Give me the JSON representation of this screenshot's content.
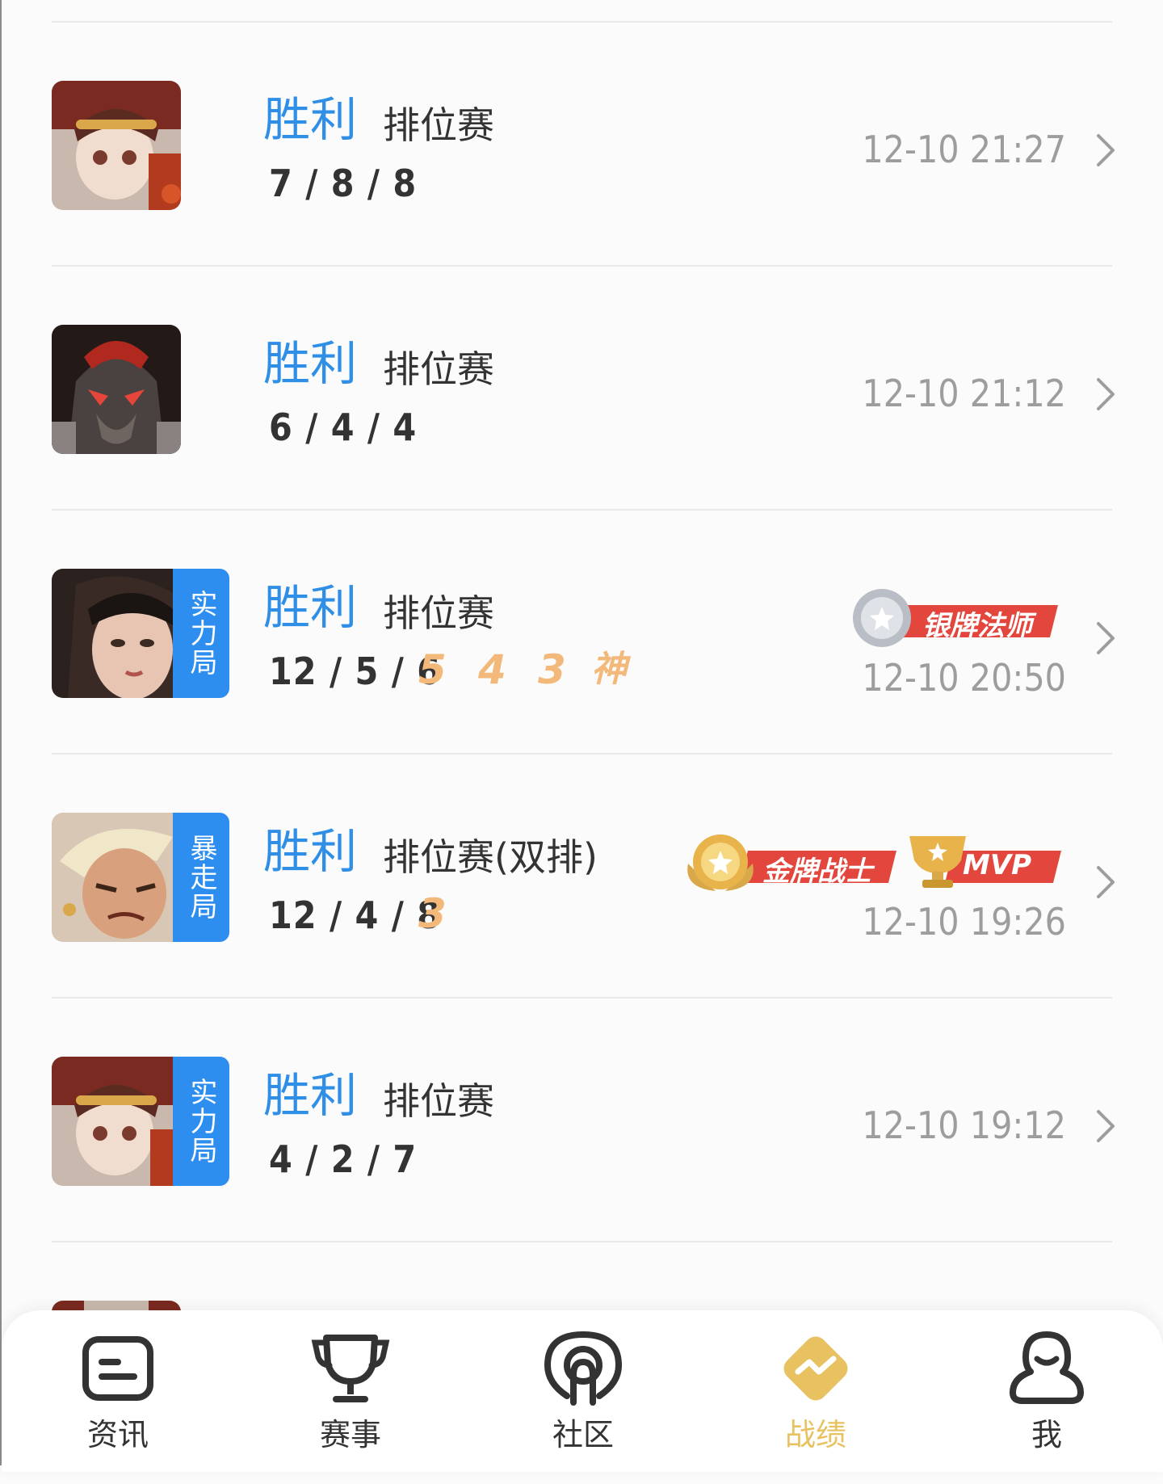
{
  "matches": [
    {
      "result": "胜利",
      "match_type": "排位赛",
      "kda": "7 / 8 / 8",
      "time": "12-10 21:27",
      "mode_tag": "",
      "multikills": [],
      "badges": []
    },
    {
      "result": "胜利",
      "match_type": "排位赛",
      "kda": "6 / 4 / 4",
      "time": "12-10 21:12",
      "mode_tag": "",
      "multikills": [],
      "badges": []
    },
    {
      "result": "胜利",
      "match_type": "排位赛",
      "kda": "12 / 5 / 6",
      "time": "12-10 20:50",
      "mode_tag": "实力局",
      "multikills": [
        "5",
        "4",
        "3",
        "神"
      ],
      "badges": [
        "银牌法师"
      ]
    },
    {
      "result": "胜利",
      "match_type": "排位赛(双排)",
      "kda": "12 / 4 / 8",
      "time": "12-10 19:26",
      "mode_tag": "暴走局",
      "multikills": [
        "3"
      ],
      "badges": [
        "金牌战士",
        "MVP"
      ]
    },
    {
      "result": "胜利",
      "match_type": "排位赛",
      "kda": "4 / 2 / 7",
      "time": "12-10 19:12",
      "mode_tag": "实力局",
      "multikills": [],
      "badges": []
    }
  ],
  "tabs": [
    {
      "label": "资讯",
      "icon": "news-icon",
      "active": false
    },
    {
      "label": "赛事",
      "icon": "trophy-icon",
      "active": false
    },
    {
      "label": "社区",
      "icon": "community-icon",
      "active": false
    },
    {
      "label": "战绩",
      "icon": "stats-icon",
      "active": true
    },
    {
      "label": "我",
      "icon": "profile-icon",
      "active": false
    }
  ],
  "colors": {
    "result": "#2f8fe6",
    "mode_tag": "#2e8ef0",
    "active_tab": "#e8c160",
    "badge_red": "#e2463d"
  }
}
